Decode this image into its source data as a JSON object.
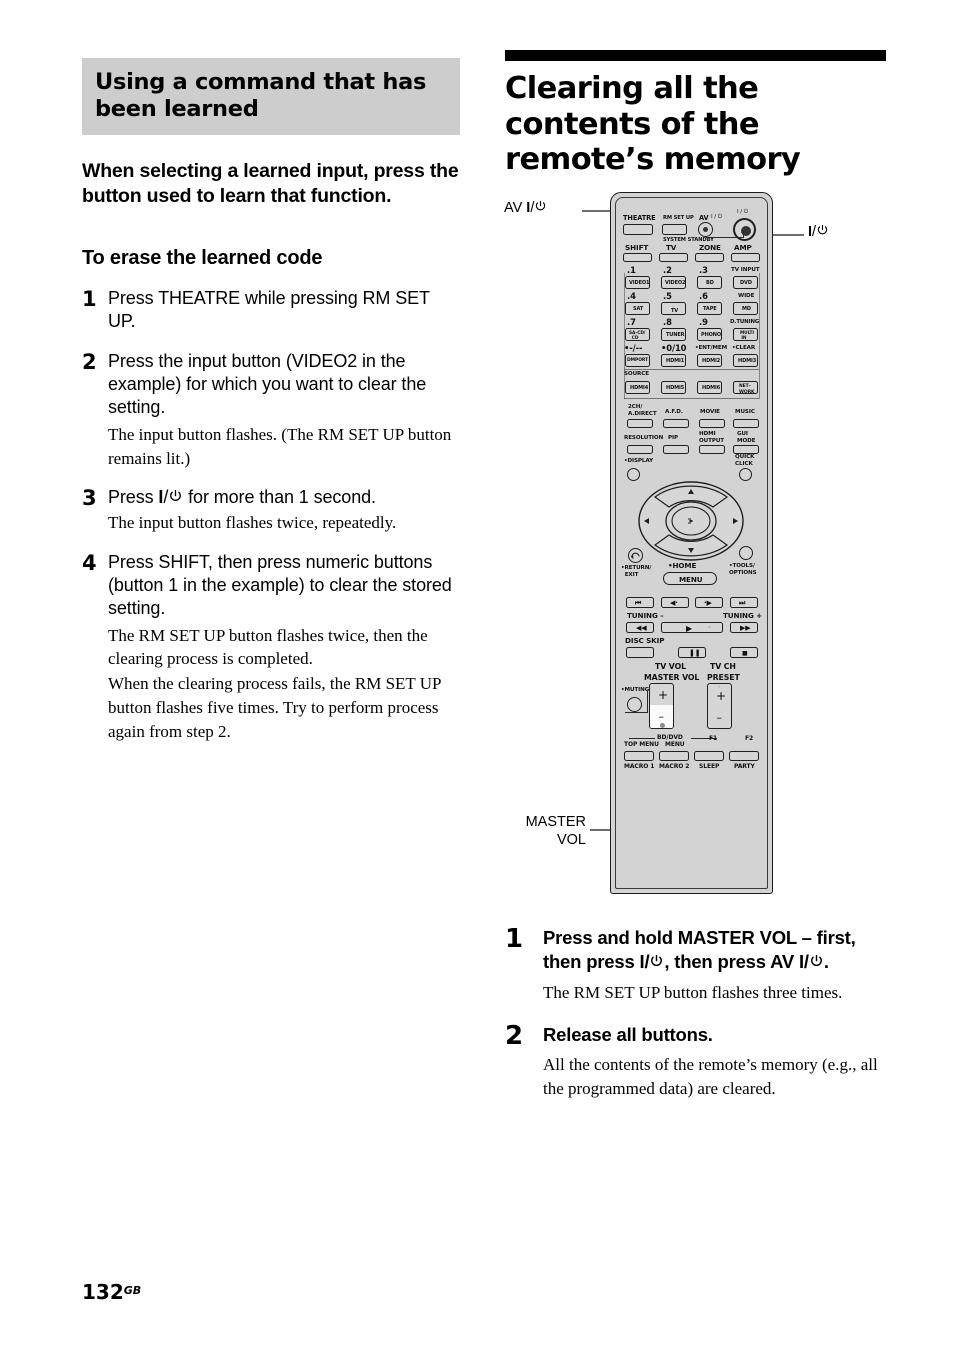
{
  "left": {
    "gray_heading": "Using a command that has been learned",
    "lead": "When selecting a learned input, press the button used to learn that function.",
    "subheading": "To erase the learned code",
    "steps": [
      {
        "num": "1",
        "title": "Press THEATRE while pressing RM SET UP.",
        "notes": []
      },
      {
        "num": "2",
        "title": "Press the input button (VIDEO2 in the example) for which you want to clear the setting.",
        "notes": [
          "The input button flashes. (The RM SET UP button remains lit.)"
        ]
      },
      {
        "num": "3",
        "title_pre": "Press ",
        "title_post": " for more than 1 second.",
        "title_icon": "power-icon",
        "notes": [
          "The input button flashes twice, repeatedly."
        ]
      },
      {
        "num": "4",
        "title": "Press SHIFT, then press numeric buttons (button 1 in the example) to clear the stored setting.",
        "notes": [
          "The RM SET UP button flashes twice, then the clearing process is completed.",
          "When the clearing process fails, the RM SET UP button flashes five times. Try to perform process again from step 2."
        ]
      }
    ]
  },
  "right": {
    "title": "Clearing all the contents of the remote’s memory",
    "steps": [
      {
        "num": "1",
        "title_a": "Press and hold MASTER VOL – first, then press ",
        "title_b": ", then press AV ",
        "title_c": ".",
        "note": "The RM SET UP button flashes three times."
      },
      {
        "num": "2",
        "title": "Release all buttons.",
        "note": "All the contents of the remote’s memory (e.g., all the programmed data) are cleared."
      }
    ]
  },
  "footer": {
    "page": "132",
    "suffix": "GB"
  },
  "figure": {
    "callouts": [
      {
        "name": "av-power-callout",
        "text": "AV I/⏻"
      },
      {
        "name": "power-callout",
        "text": "I/⏻"
      },
      {
        "name": "master-vol-callout",
        "line1": "MASTER",
        "line2": "VOL"
      }
    ],
    "remote": {
      "top_row": [
        "THEATRE",
        "RM SET UP",
        "AV",
        "I / ⏻"
      ],
      "av_power_label": "AV",
      "power_label": "I / ⏻",
      "system_standby": "SYSTEM STANDBY",
      "mode_row": [
        "SHIFT",
        "TV",
        "ZONE",
        "AMP"
      ],
      "numeric_top": [
        ".1",
        ".2",
        ".3",
        "TV INPUT"
      ],
      "numeric_top_btn": [
        "VIDEO1",
        "VIDEO2",
        "BD",
        "DVD"
      ],
      "numeric_mid": [
        ".4",
        ".5",
        ".6",
        "WIDE"
      ],
      "numeric_mid_btn": [
        "SAT",
        "TV",
        "TAPE",
        "MD"
      ],
      "numeric_low": [
        ".7",
        ".8",
        ".9",
        "D.TUNING"
      ],
      "numeric_low_btn": [
        "SA-CD/ CD",
        "TUNER",
        "PHONO",
        "MULTI IN"
      ],
      "numeric_bot": [
        "•-/--",
        "•0/10",
        "•ENT/MEM",
        "•CLEAR"
      ],
      "numeric_bot_btn": [
        "DMPORT",
        "HDMI1",
        "HDMI2",
        "HDMI3"
      ],
      "source_label": "SOURCE",
      "source_btn": [
        "HDMI4",
        "HDMI5",
        "HDMI6",
        "NET- WORK"
      ],
      "sound_row": [
        "2CH/ A.DIRECT",
        "A.F.D.",
        "MOVIE",
        "MUSIC"
      ],
      "video_row": [
        "RESOLUTION",
        "PIP",
        "HDMI OUTPUT",
        "GUI MODE"
      ],
      "display_label": "•DISPLAY",
      "quick_click": "QUICK CLICK",
      "return_label": "•RETURN/ EXIT",
      "home_label": "•HOME",
      "menu_label": "MENU",
      "tools_label": "•TOOLS/ OPTIONS",
      "tuning_minus": "TUNING –",
      "tuning_plus": "TUNING +",
      "disc_skip": "DISC SKIP",
      "tv_vol": "TV VOL",
      "master_vol": "MASTER VOL",
      "tv_ch": "TV CH",
      "preset": "PRESET",
      "muting": "•MUTING",
      "vol_plus": "+",
      "vol_minus": "–",
      "bd_dvd": "BD/DVD",
      "top_menu": "TOP MENU",
      "menu2": "MENU",
      "f1": "F1",
      "f2": "F2",
      "macro1": "MACRO 1",
      "macro2": "MACRO 2",
      "sleep": "SLEEP",
      "party": "PARTY"
    }
  },
  "colors": {
    "gray_header": "#cdcdcd",
    "black_bar": "#000000",
    "remote_body": "#d3d3d3",
    "callout_line": "#6d6d6d"
  }
}
